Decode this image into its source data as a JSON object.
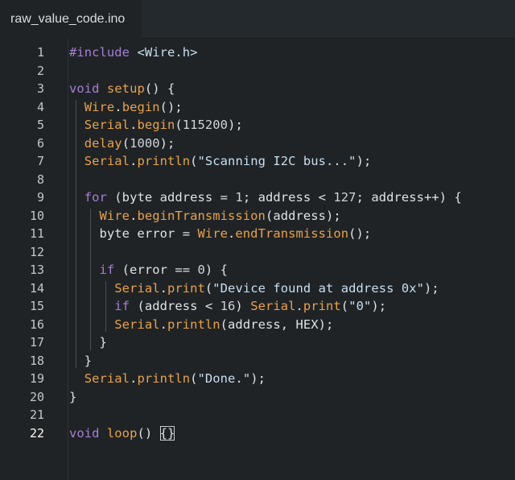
{
  "tab": {
    "title": "raw_value_code.ino"
  },
  "colors": {
    "background": "#1f2326",
    "keyword": "#a77fd6",
    "function": "#e8a24a",
    "string": "#c9dfef",
    "text": "#dfe3e6",
    "line_number": "#c2c7cc"
  },
  "editor": {
    "active_line": 22,
    "lines": [
      {
        "n": "1",
        "tokens": [
          [
            "kw",
            "#include "
          ],
          [
            "str",
            "<Wire.h>"
          ]
        ]
      },
      {
        "n": "2",
        "tokens": []
      },
      {
        "n": "3",
        "tokens": [
          [
            "kw",
            "void "
          ],
          [
            "fn",
            "setup"
          ],
          [
            "plain",
            "() {"
          ]
        ]
      },
      {
        "n": "4",
        "tokens": [
          [
            "plain",
            "  "
          ],
          [
            "fn",
            "Wire"
          ],
          [
            "plain",
            "."
          ],
          [
            "fn",
            "begin"
          ],
          [
            "plain",
            "();"
          ]
        ]
      },
      {
        "n": "5",
        "tokens": [
          [
            "plain",
            "  "
          ],
          [
            "fn",
            "Serial"
          ],
          [
            "plain",
            "."
          ],
          [
            "fn",
            "begin"
          ],
          [
            "plain",
            "("
          ],
          [
            "num",
            "115200"
          ],
          [
            "plain",
            ");"
          ]
        ]
      },
      {
        "n": "6",
        "tokens": [
          [
            "plain",
            "  "
          ],
          [
            "fn",
            "delay"
          ],
          [
            "plain",
            "("
          ],
          [
            "num",
            "1000"
          ],
          [
            "plain",
            ");"
          ]
        ]
      },
      {
        "n": "7",
        "tokens": [
          [
            "plain",
            "  "
          ],
          [
            "fn",
            "Serial"
          ],
          [
            "plain",
            "."
          ],
          [
            "fn",
            "println"
          ],
          [
            "plain",
            "("
          ],
          [
            "str",
            "\"Scanning I2C bus...\""
          ],
          [
            "plain",
            ");"
          ]
        ]
      },
      {
        "n": "8",
        "tokens": []
      },
      {
        "n": "9",
        "tokens": [
          [
            "plain",
            "  "
          ],
          [
            "kw",
            "for"
          ],
          [
            "plain",
            " (byte address = "
          ],
          [
            "num",
            "1"
          ],
          [
            "plain",
            "; address < "
          ],
          [
            "num",
            "127"
          ],
          [
            "plain",
            "; address++) {"
          ]
        ]
      },
      {
        "n": "10",
        "tokens": [
          [
            "plain",
            "    "
          ],
          [
            "fn",
            "Wire"
          ],
          [
            "plain",
            "."
          ],
          [
            "fn",
            "beginTransmission"
          ],
          [
            "plain",
            "(address);"
          ]
        ]
      },
      {
        "n": "11",
        "tokens": [
          [
            "plain",
            "    byte error = "
          ],
          [
            "fn",
            "Wire"
          ],
          [
            "plain",
            "."
          ],
          [
            "fn",
            "endTransmission"
          ],
          [
            "plain",
            "();"
          ]
        ]
      },
      {
        "n": "12",
        "tokens": []
      },
      {
        "n": "13",
        "tokens": [
          [
            "plain",
            "    "
          ],
          [
            "kw",
            "if"
          ],
          [
            "plain",
            " (error == "
          ],
          [
            "num",
            "0"
          ],
          [
            "plain",
            ") {"
          ]
        ]
      },
      {
        "n": "14",
        "tokens": [
          [
            "plain",
            "      "
          ],
          [
            "fn",
            "Serial"
          ],
          [
            "plain",
            "."
          ],
          [
            "fn",
            "print"
          ],
          [
            "plain",
            "("
          ],
          [
            "str",
            "\"Device found at address 0x\""
          ],
          [
            "plain",
            ");"
          ]
        ]
      },
      {
        "n": "15",
        "tokens": [
          [
            "plain",
            "      "
          ],
          [
            "kw",
            "if"
          ],
          [
            "plain",
            " (address < "
          ],
          [
            "num",
            "16"
          ],
          [
            "plain",
            ") "
          ],
          [
            "fn",
            "Serial"
          ],
          [
            "plain",
            "."
          ],
          [
            "fn",
            "print"
          ],
          [
            "plain",
            "("
          ],
          [
            "str",
            "\"0\""
          ],
          [
            "plain",
            ");"
          ]
        ]
      },
      {
        "n": "16",
        "tokens": [
          [
            "plain",
            "      "
          ],
          [
            "fn",
            "Serial"
          ],
          [
            "plain",
            "."
          ],
          [
            "fn",
            "println"
          ],
          [
            "plain",
            "(address, HEX);"
          ]
        ]
      },
      {
        "n": "17",
        "tokens": [
          [
            "plain",
            "    }"
          ]
        ]
      },
      {
        "n": "18",
        "tokens": [
          [
            "plain",
            "  }"
          ]
        ]
      },
      {
        "n": "19",
        "tokens": [
          [
            "plain",
            "  "
          ],
          [
            "fn",
            "Serial"
          ],
          [
            "plain",
            "."
          ],
          [
            "fn",
            "println"
          ],
          [
            "plain",
            "("
          ],
          [
            "str",
            "\"Done.\""
          ],
          [
            "plain",
            ");"
          ]
        ]
      },
      {
        "n": "20",
        "tokens": [
          [
            "plain",
            "}"
          ]
        ]
      },
      {
        "n": "21",
        "tokens": []
      },
      {
        "n": "22",
        "tokens": [
          [
            "kw",
            "void "
          ],
          [
            "fn",
            "loop"
          ],
          [
            "plain",
            "() "
          ],
          [
            "cursor",
            "{}"
          ]
        ]
      }
    ]
  }
}
